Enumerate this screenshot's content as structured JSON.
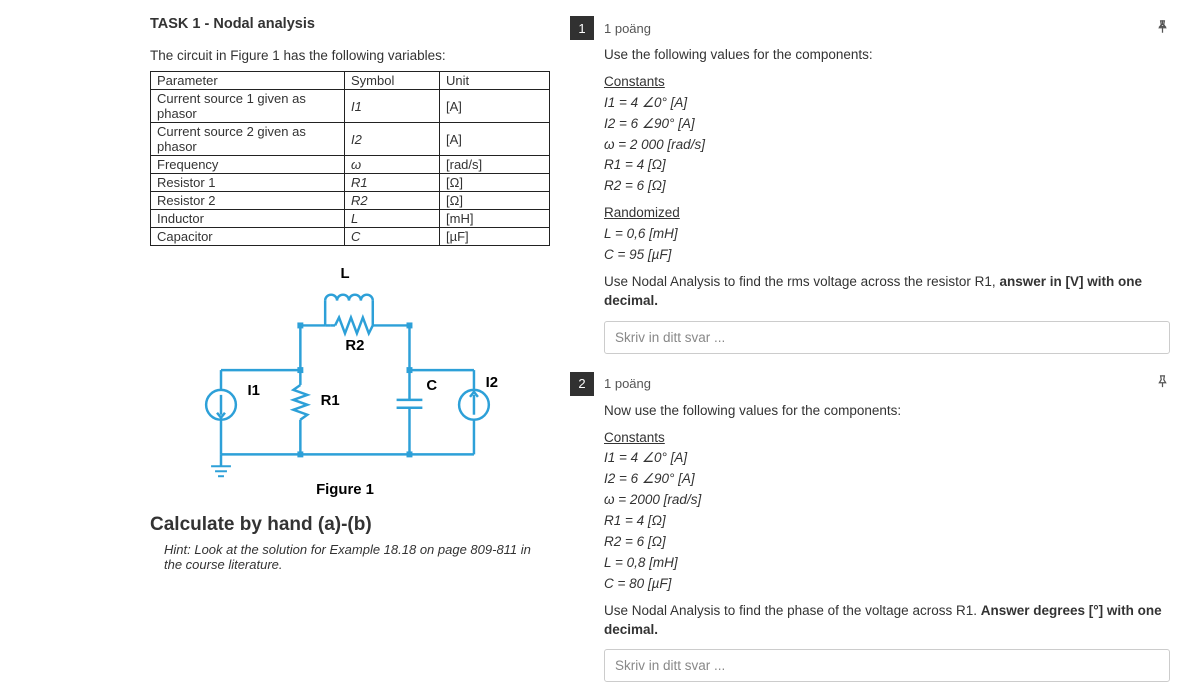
{
  "task": {
    "title": "TASK 1 - Nodal analysis",
    "intro": "The circuit in Figure 1 has the following variables:",
    "table": {
      "headers": {
        "param": "Parameter",
        "symbol": "Symbol",
        "unit": "Unit"
      },
      "rows": [
        {
          "param": "Current source 1 given as phasor",
          "symbol": "I1",
          "unit": "[A]"
        },
        {
          "param": "Current source 2 given as phasor",
          "symbol": "I2",
          "unit": "[A]"
        },
        {
          "param": "Frequency",
          "symbol": "ω",
          "unit": "[rad/s]"
        },
        {
          "param": "Resistor 1",
          "symbol": "R1",
          "unit": "[Ω]"
        },
        {
          "param": "Resistor 2",
          "symbol": "R2",
          "unit": "[Ω]"
        },
        {
          "param": "Inductor",
          "symbol": "L",
          "unit": "[mH]"
        },
        {
          "param": "Capacitor",
          "symbol": "C",
          "unit": "[µF]"
        }
      ]
    },
    "fig": {
      "L": "L",
      "R2": "R2",
      "I1": "I1",
      "R1": "R1",
      "C": "C",
      "I2": "I2",
      "caption": "Figure 1"
    },
    "calc_heading": "Calculate by hand (a)-(b)",
    "hint": "Hint: Look at the solution for Example 18.18 on page 809-811 in the course literature."
  },
  "q1": {
    "num": "1",
    "pts": "1 poäng",
    "intro": "Use the following values for the components:",
    "constants_h": "Constants",
    "c1": "I1 = 4 ∠0° [A]",
    "c2": "I2 = 6 ∠90° [A]",
    "c3": "ω = 2 000 [rad/s]",
    "c4": "R1 = 4 [Ω]",
    "c5": "R2 = 6 [Ω]",
    "rand_h": "Randomized",
    "r1": "L = 0,6 [mH]",
    "r2": "C = 95 [µF]",
    "prompt_a": "Use Nodal Analysis to find the rms voltage across the resistor R1, ",
    "prompt_b": "answer in [V] with one decimal.",
    "placeholder": "Skriv in ditt svar ..."
  },
  "q2": {
    "num": "2",
    "pts": "1 poäng",
    "intro": "Now use the following values for the components:",
    "constants_h": "Constants",
    "c1": "I1 = 4 ∠0° [A]",
    "c2": "I2 = 6 ∠90° [A]",
    "c3": "ω = 2000 [rad/s]",
    "c4": "R1 = 4 [Ω]",
    "c5": "R2 = 6 [Ω]",
    "c6": "L = 0,8 [mH]",
    "c7": "C = 80 [µF]",
    "prompt_a": "Use Nodal Analysis to find the phase of the voltage across R1. ",
    "prompt_b": "Answer degrees [°] with one decimal.",
    "placeholder": "Skriv in ditt svar ..."
  }
}
